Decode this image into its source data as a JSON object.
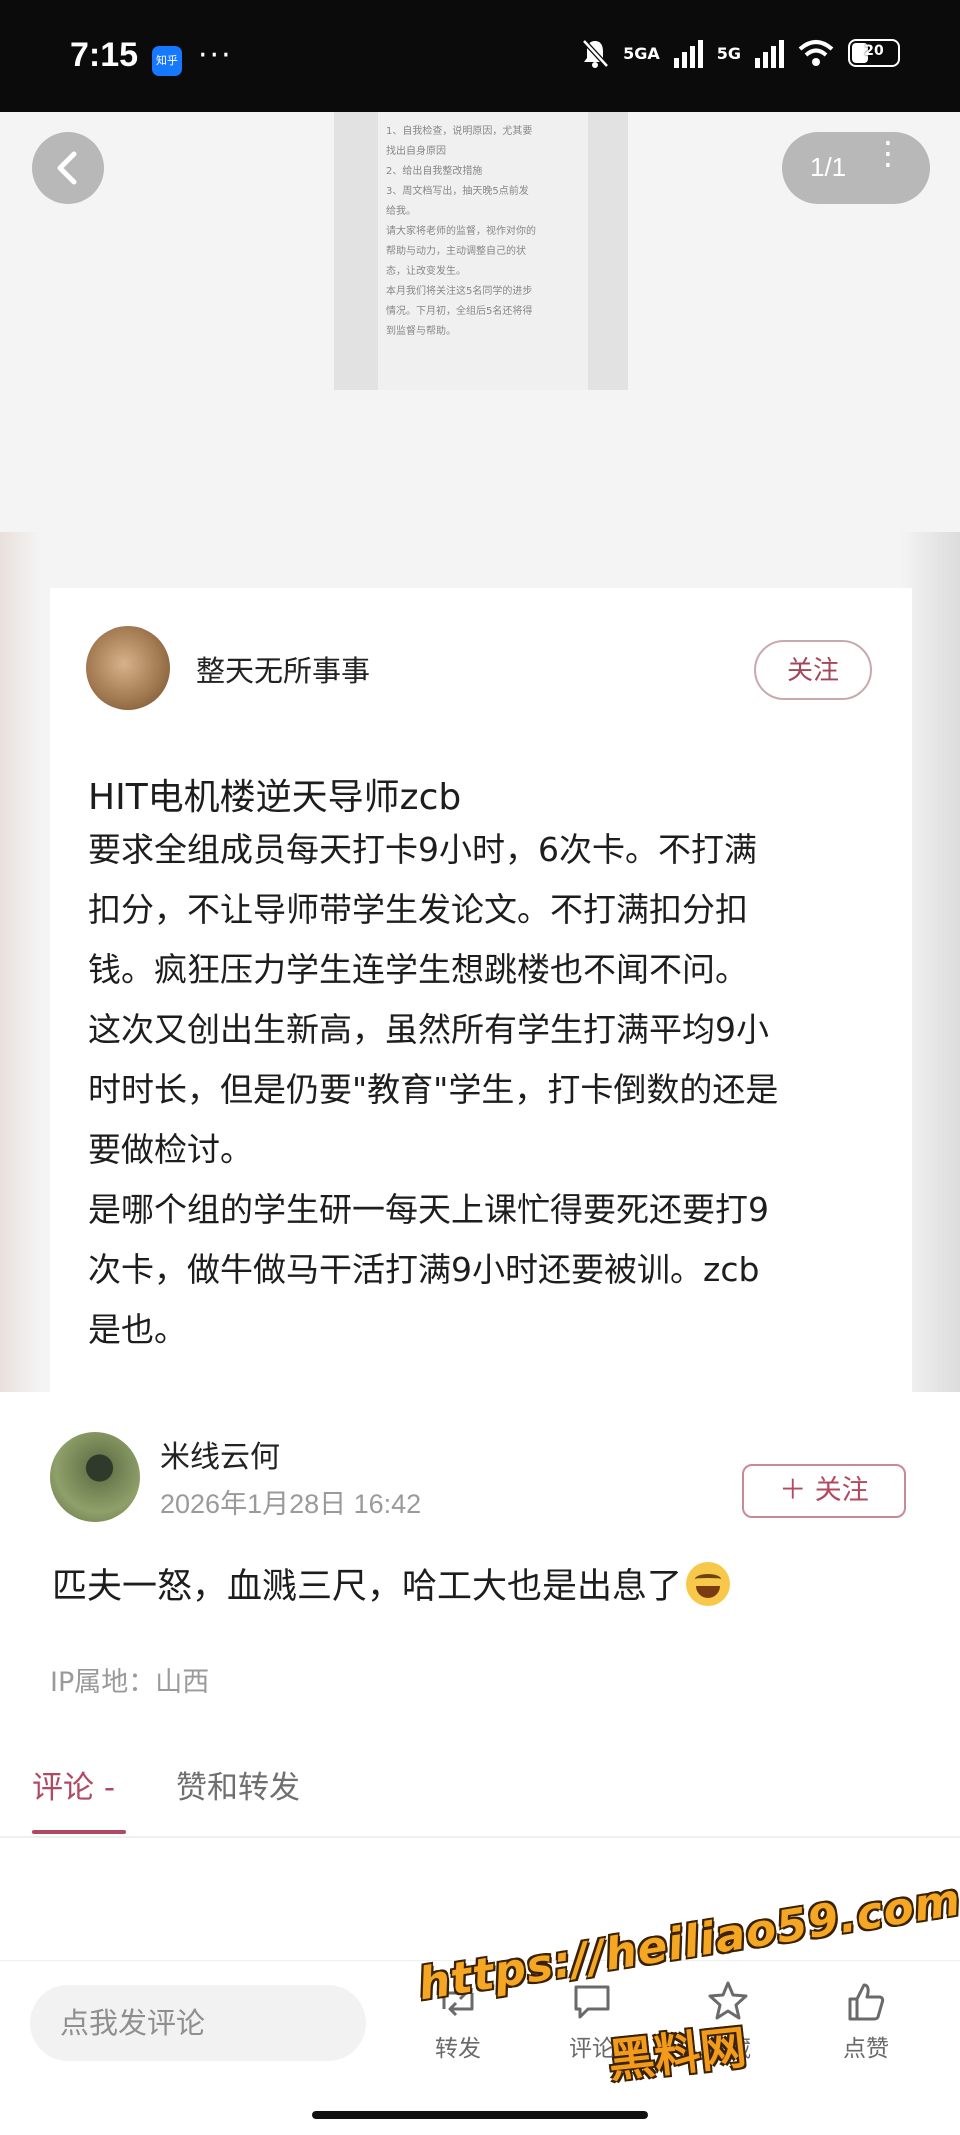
{
  "status_bar": {
    "time": "7:15",
    "app_badge": "知乎",
    "more": "···",
    "network_1": "5GA",
    "network_2": "5G",
    "battery": "20"
  },
  "viewer": {
    "page_counter": "1/1",
    "screenshot_lines": [
      "1、自我检查，说明原因，尤其要",
      "找出自身原因",
      "2、给出自我整改措施",
      "3、周文档写出，抽天晚5点前发",
      "给我。",
      "请大家将老师的监督，视作对你的",
      "帮助与动力，主动调整自己的状",
      "态，让改变发生。",
      "本月我们将关注这5名同学的进步",
      "情况。下月初，全组后5名还将得",
      "到监督与帮助。"
    ]
  },
  "post": {
    "author": "整天无所事事",
    "follow_label": "关注",
    "title": "HIT电机楼逆天导师zcb",
    "body_lines": [
      "要求全组成员每天打卡9小时，6次卡。不打满",
      "扣分，不让导师带学生发论文。不打满扣分扣",
      "钱。疯狂压力学生连学生想跳楼也不闻不问。",
      "这次又创出生新高，虽然所有学生打满平均9小",
      "时时长，但是仍要\"教育\"学生，打卡倒数的还是",
      "要做检讨。",
      "是哪个组的学生研一每天上课忙得要死还要打9",
      "次卡，做牛做马干活打满9小时还要被训。zcb",
      "是也。"
    ]
  },
  "comment": {
    "author": "米线云何",
    "timestamp": "2026年1月28日 16:42",
    "follow_label": "＋ 关注",
    "text": "匹夫一怒，血溅三尺，哈工大也是出息了",
    "ip_location": "IP属地：山西"
  },
  "tabs": {
    "active": "评论 -",
    "inactive": "赞和转发"
  },
  "bottom_bar": {
    "comment_placeholder": "点我发评论",
    "actions": [
      "转发",
      "评论",
      "收藏",
      "点赞"
    ]
  },
  "watermark": {
    "url": "https://heiliao59.com",
    "name": "黑料网"
  },
  "colors": {
    "accent": "#b04a62",
    "follow_border": "#c98a96",
    "status_bar_bg": "#0b0b0b"
  }
}
